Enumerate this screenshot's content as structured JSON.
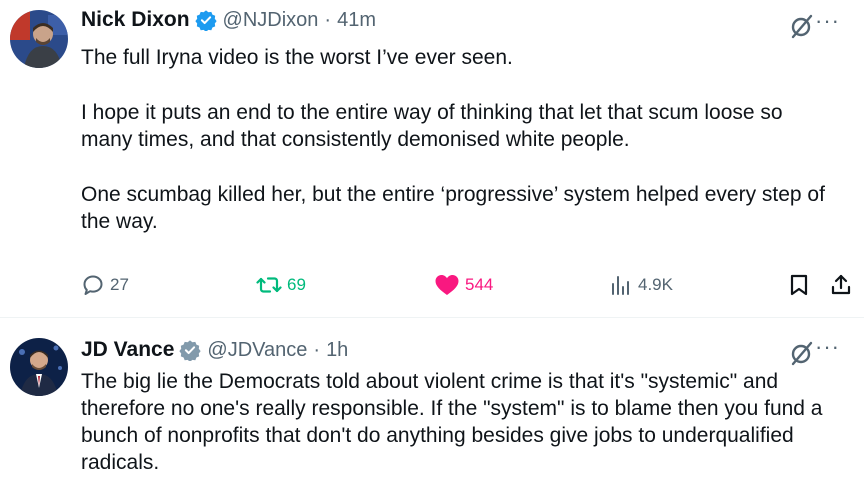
{
  "tweets": [
    {
      "name": "Nick Dixon",
      "handle": "@NJDixon",
      "separator": "·",
      "time": "41m",
      "paragraphs": [
        "The full Iryna video is the worst I’ve ever seen.",
        "I hope it puts an end to the entire way of thinking that let that scum loose so many times, and that consistently demonised white people.",
        "One scumbag killed her, but the entire ‘progressive’ system helped every step of the way."
      ],
      "more_label": "···",
      "stats": {
        "replies": "27",
        "reposts": "69",
        "likes": "544",
        "views": "4.9K"
      },
      "icons": [
        "verified-badge-icon",
        "grok-icon",
        "more-icon",
        "reply-icon",
        "repost-icon",
        "heart-icon",
        "views-icon",
        "bookmark-icon",
        "share-icon"
      ]
    },
    {
      "name": "JD Vance",
      "handle": "@JDVance",
      "separator": "·",
      "time": "1h",
      "paragraphs": [
        "The big lie the Democrats told about violent crime is that it's \"systemic\" and therefore no one's really responsible. If the \"system\" is to blame then you fund a bunch of nonprofits that don't do anything besides give jobs to underqualified radicals."
      ],
      "more_label": "···",
      "icons": [
        "verified-badge-icon",
        "grok-icon",
        "more-icon"
      ]
    }
  ],
  "colors": {
    "verified": "#1d9bf0",
    "secondary_text": "#536471",
    "repost_active": "#00ba7c",
    "like_active": "#f91880",
    "divider": "#eff3f4"
  }
}
